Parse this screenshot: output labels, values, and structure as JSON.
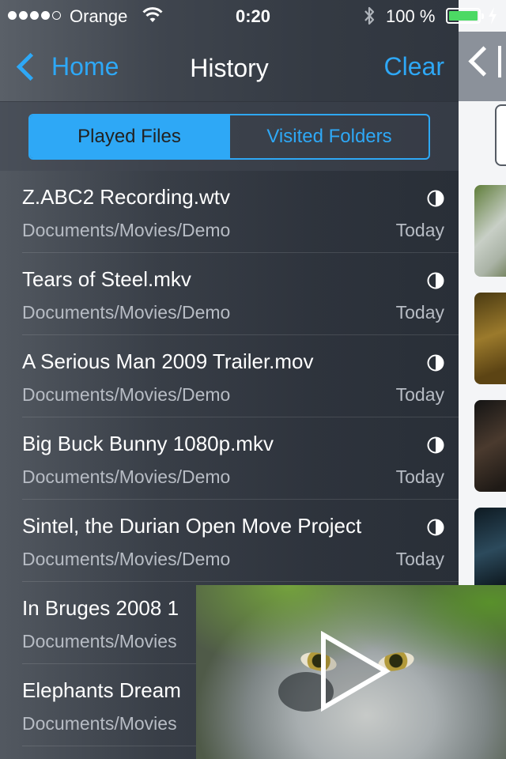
{
  "status_bar": {
    "carrier": "Orange",
    "time": "0:20",
    "battery_percent": "100 %"
  },
  "nav": {
    "back_label": "Home",
    "title": "History",
    "clear_label": "Clear"
  },
  "segmented": {
    "selected_label": "Played Files",
    "other_label": "Visited Folders"
  },
  "history": [
    {
      "title": "Z.ABC2 Recording.wtv",
      "path": "Documents/Movies/Demo",
      "date": "Today"
    },
    {
      "title": "Tears of Steel.mkv",
      "path": "Documents/Movies/Demo",
      "date": "Today"
    },
    {
      "title": "A Serious Man 2009 Trailer.mov",
      "path": "Documents/Movies/Demo",
      "date": "Today"
    },
    {
      "title": "Big Buck Bunny 1080p.mkv",
      "path": "Documents/Movies/Demo",
      "date": "Today"
    },
    {
      "title": "Sintel, the Durian Open Move Project",
      "path": "Documents/Movies/Demo",
      "date": "Today"
    },
    {
      "title": "In Bruges 2008 1",
      "path": "Documents/Movies",
      "date": ""
    },
    {
      "title": "Elephants Dream",
      "path": "Documents/Movies",
      "date": ""
    }
  ],
  "colors": {
    "accent": "#2ea8f6",
    "battery": "#4cd964"
  }
}
